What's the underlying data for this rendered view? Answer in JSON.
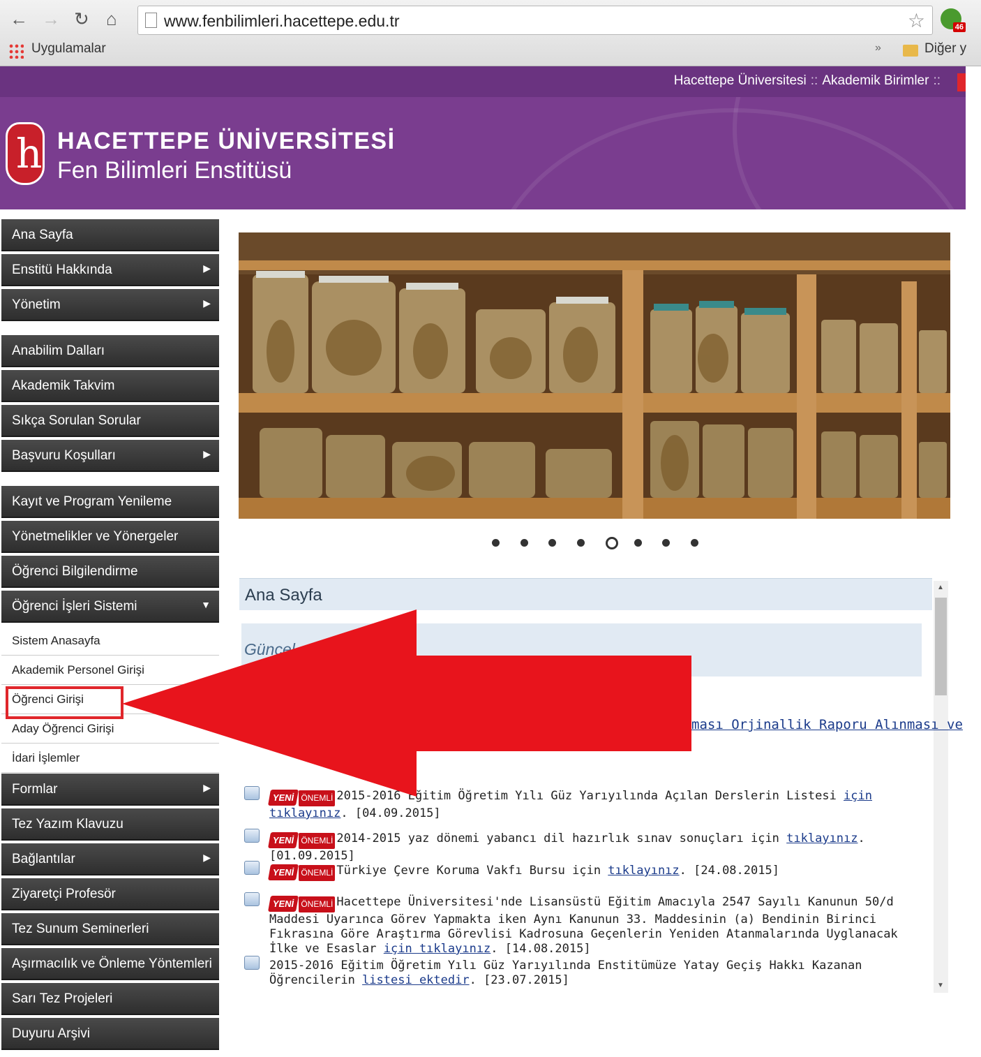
{
  "browser": {
    "url": "www.fenbilimleri.hacettepe.edu.tr",
    "apps_label": "Uygulamalar",
    "bookmarks_more": "»",
    "other_bookmarks": "Diğer y",
    "extension_badge": "46"
  },
  "header": {
    "topnav": [
      "Hacettepe Üniversitesi",
      "::",
      "Akademik Birimler",
      "::"
    ],
    "title": "HACETTEPE ÜNİVERSİTESİ",
    "subtitle": "Fen Bilimleri Enstitüsü",
    "brand_color": "#7a3d8f"
  },
  "sidebar": {
    "items": [
      {
        "label": "Ana Sayfa",
        "arrow": ""
      },
      {
        "label": "Enstitü Hakkında",
        "arrow": "▶"
      },
      {
        "label": "Yönetim",
        "arrow": "▶"
      },
      {
        "label": "Anabilim Dalları",
        "arrow": ""
      },
      {
        "label": "Akademik Takvim",
        "arrow": ""
      },
      {
        "label": "Sıkça Sorulan Sorular",
        "arrow": ""
      },
      {
        "label": "Başvuru Koşulları",
        "arrow": "▶"
      },
      {
        "label": "Kayıt ve Program Yenileme",
        "arrow": ""
      },
      {
        "label": "Yönetmelikler ve Yönergeler",
        "arrow": ""
      },
      {
        "label": "Öğrenci Bilgilendirme",
        "arrow": ""
      },
      {
        "label": "Öğrenci İşleri Sistemi",
        "arrow": "▼"
      },
      {
        "label": "Formlar",
        "arrow": "▶"
      },
      {
        "label": "Tez Yazım Klavuzu",
        "arrow": ""
      },
      {
        "label": "Bağlantılar",
        "arrow": "▶"
      },
      {
        "label": "Ziyaretçi Profesör",
        "arrow": ""
      },
      {
        "label": "Tez Sunum Seminerleri",
        "arrow": ""
      },
      {
        "label": "Aşırmacılık ve Önleme Yöntemleri",
        "arrow": ""
      },
      {
        "label": "Sarı Tez Projeleri",
        "arrow": ""
      },
      {
        "label": "Duyuru Arşivi",
        "arrow": ""
      }
    ],
    "subitems": [
      {
        "label": "Sistem Anasayfa"
      },
      {
        "label": "Akademik Personel Girişi"
      },
      {
        "label": "Öğrenci Girişi"
      },
      {
        "label": "Aday Öğrenci Girişi"
      },
      {
        "label": "İdari İşlemler"
      }
    ]
  },
  "slider": {
    "dot_count": 8,
    "active_dot": 5
  },
  "main": {
    "panel_title": "Ana Sayfa",
    "guncel_label": "Güncel",
    "cut_link": "ması Orjinallik Raporu Alınması ve",
    "tag_yeni": "YENİ",
    "tag_onemli": "ÖNEMLİ",
    "news": [
      {
        "text": "2015-2016 Eğitim Öğretim Yılı Güz Yarıyılında Açılan Derslerin Listesi ",
        "link": "için tıklayınız",
        "date": ". [04.09.2015]"
      },
      {
        "text": "2014-2015 yaz dönemi yabancı dil hazırlık sınav sonuçları için ",
        "link": "tıklayınız",
        "date": ". [01.09.2015]"
      },
      {
        "text": "Türkiye Çevre Koruma Vakfı Bursu için ",
        "link": "tıklayınız",
        "date": ". [24.08.2015]"
      },
      {
        "text": "Hacettepe Üniversitesi'nde Lisansüstü Eğitim Amacıyla 2547 Sayılı Kanunun 50/d Maddesi Uyarınca Görev Yapmakta iken Aynı Kanunun 33. Maddesinin (a) Bendinin Birinci Fıkrasına Göre Araştırma Görevlisi Kadrosuna Geçenlerin Yeniden Atanmalarında Uyglanacak İlke ve Esaslar ",
        "link": "için tıklayınız",
        "date": ". [14.08.2015]"
      },
      {
        "text": "2015-2016 Eğitim Öğretim Yılı Güz Yarıyılında Enstitümüze Yatay Geçiş Hakkı Kazanan Öğrencilerin ",
        "link": "listesi ektedir",
        "date": ". [23.07.2015]"
      }
    ]
  },
  "overlay": {
    "arrow_color": "#e8141c"
  }
}
